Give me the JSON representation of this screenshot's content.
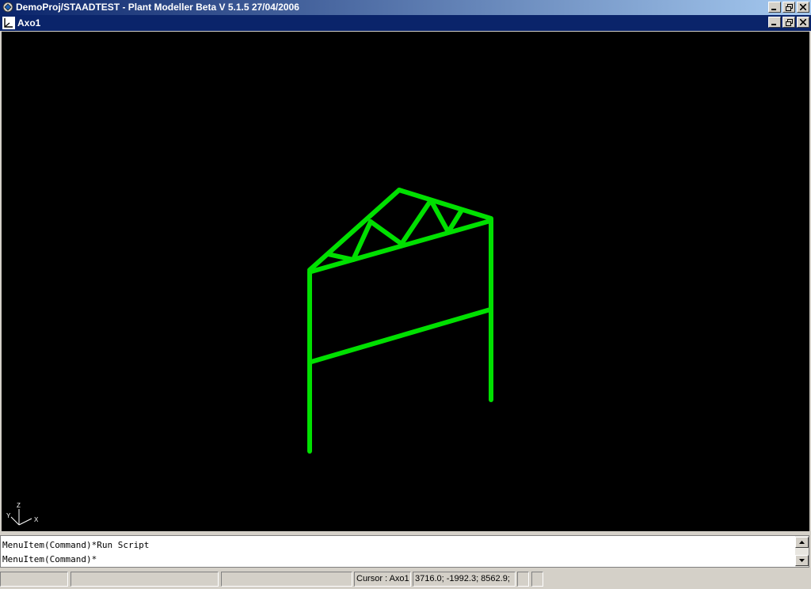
{
  "window": {
    "title": "DemoProj/STAADTEST - Plant Modeller Beta V 5.1.5 27/04/2006"
  },
  "view": {
    "title": "Axo1",
    "axes": {
      "z_label": "Z",
      "y_label": "Y",
      "x_label": "X"
    },
    "model_color": "#00e000",
    "background": "#000000"
  },
  "log": {
    "lines": [
      "MenuItem(Command)*Run Script",
      "MenuItem(Command)*"
    ]
  },
  "statusbar": {
    "cursor_label": "Cursor : Axo1",
    "coords": "3716.0; -1992.3; 8562.9;"
  },
  "icons": {
    "app": "plant-modeller-icon",
    "view": "axonometric-view-icon"
  }
}
